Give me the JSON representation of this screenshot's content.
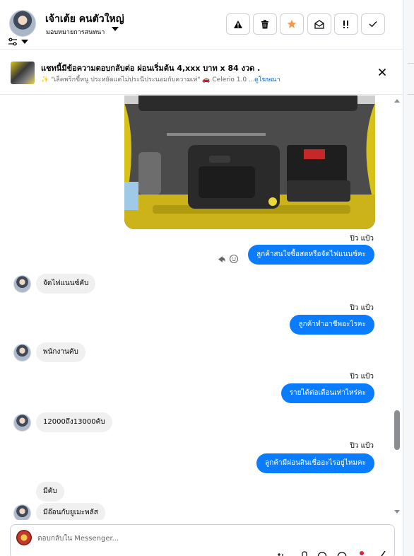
{
  "header": {
    "contact_name": "เจ้าเต้ย คนตัวใหญ่",
    "assign_label": "มอบหมายการสนทนา"
  },
  "toolbar": {
    "buttons": [
      {
        "name": "spam",
        "icon": "warning-icon"
      },
      {
        "name": "delete",
        "icon": "trash-icon"
      },
      {
        "name": "star",
        "icon": "star-icon",
        "color": "#f2994a"
      },
      {
        "name": "mark-unread",
        "icon": "envelope-open-icon"
      },
      {
        "name": "follow-up",
        "icon": "exclamation-icon"
      },
      {
        "name": "done",
        "icon": "check-icon"
      }
    ]
  },
  "ad": {
    "title": "แชทนี้มีข้อความตอบกลับต่อ ผ่อนเริ่มต้น 4,xxx บาท x 84 งวด .",
    "subtitle": "✨ \"เล็คพริกขี้หนู ประหยัดแต่ไม่ประนีประนอมกับความเท่\" 🚗 Celerio 1.0 ...",
    "link": "ดูโฆษณา"
  },
  "messages": [
    {
      "dir": "out",
      "sender": "ปิว แป้ว",
      "text": "ลูกค้าสนใจซื้อสดหรือจัดไฟแนนซ์คะ"
    },
    {
      "dir": "in",
      "text": "จัดไฟแนนซ์คับ"
    },
    {
      "dir": "out",
      "sender": "ปิว แป้ว",
      "text": "ลูกค้าทำอาชีพอะไรคะ"
    },
    {
      "dir": "in",
      "text": "พนักงานคับ"
    },
    {
      "dir": "out",
      "sender": "ปิว แป้ว",
      "text": "รายได้ต่อเดือนเท่าไหร่คะ"
    },
    {
      "dir": "in",
      "text": "12000ถึง13000คับ"
    },
    {
      "dir": "out",
      "sender": "ปิว แป้ว",
      "text": "ลูกค้ามีผ่อนสินเชื่ออะไรอยู่ไหมคะ"
    },
    {
      "dir": "in",
      "text": "มีคับ"
    },
    {
      "dir": "in",
      "text": "มีอ๊อนกับยูเมะพลัส"
    }
  ],
  "composer": {
    "placeholder": "ตอบกลับใน Messenger..."
  },
  "colors": {
    "accent": "#0a7cff",
    "incoming_bubble": "#f0f0f0",
    "link": "#0a66c2",
    "star": "#f2994a"
  }
}
